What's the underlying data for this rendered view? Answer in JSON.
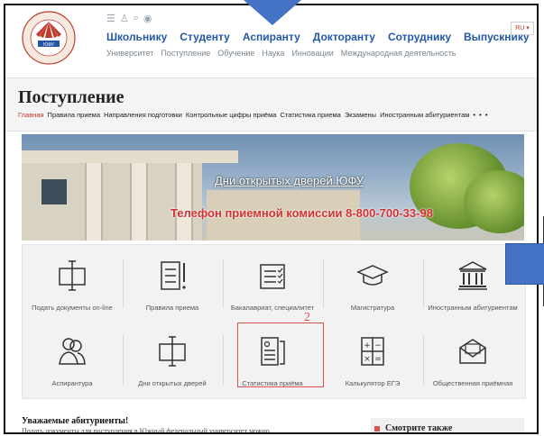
{
  "header": {
    "logo_text": "ЮЖНЫЙ ФЕДЕРАЛЬНЫЙ УНИВЕРСИТЕТ",
    "logo_label": "ЮФУ",
    "lang": "RU ▾",
    "main_nav": [
      "Школьнику",
      "Студенту",
      "Аспиранту",
      "Докторанту",
      "Сотруднику",
      "Выпускнику"
    ],
    "sub_nav": [
      "Университет",
      "Поступление",
      "Обучение",
      "Наука",
      "Инновации",
      "Международная деятельность"
    ]
  },
  "page": {
    "title": "Поступление",
    "breadcrumbs": [
      "Главная",
      "Правила приема",
      "Направления подготовки",
      "Контрольные цифры приёма",
      "Статистика приема",
      "Экзамены",
      "Иностранным абитуриентам"
    ],
    "more": "• • •"
  },
  "banner": {
    "line1": "Дни открытых дверей ЮФУ",
    "line2": "Телефон приемной комиссии 8-800-700-33-98"
  },
  "tiles": [
    {
      "label": "Подать документы on-line",
      "icon": "pen-document-icon"
    },
    {
      "label": "Правила приема",
      "icon": "rules-document-icon"
    },
    {
      "label": "Бакалавриат, специалитет",
      "icon": "checklist-icon"
    },
    {
      "label": "Магистратура",
      "icon": "graduation-cap-icon"
    },
    {
      "label": "Иностранным абитуриентам",
      "icon": "university-building-icon"
    },
    {
      "label": "Аспирантура",
      "icon": "people-icon"
    },
    {
      "label": "Дни открытых дверей",
      "icon": "pen-document-icon"
    },
    {
      "label": "Статистика приёма",
      "icon": "statistics-document-icon"
    },
    {
      "label": "Калькулятор ЕГЭ",
      "icon": "calculator-icon"
    },
    {
      "label": "Общественная приёмная",
      "icon": "envelope-icon"
    }
  ],
  "annotation_number": "2",
  "bottom": {
    "heading": "Уважаемые абитуриенты!",
    "text": "Подать документы для поступления в Южный федеральный университет можно",
    "see_also": "Смотрите также"
  },
  "colors": {
    "accent": "#2458a6",
    "highlight": "#d9534f",
    "marker": "#4472c4"
  }
}
